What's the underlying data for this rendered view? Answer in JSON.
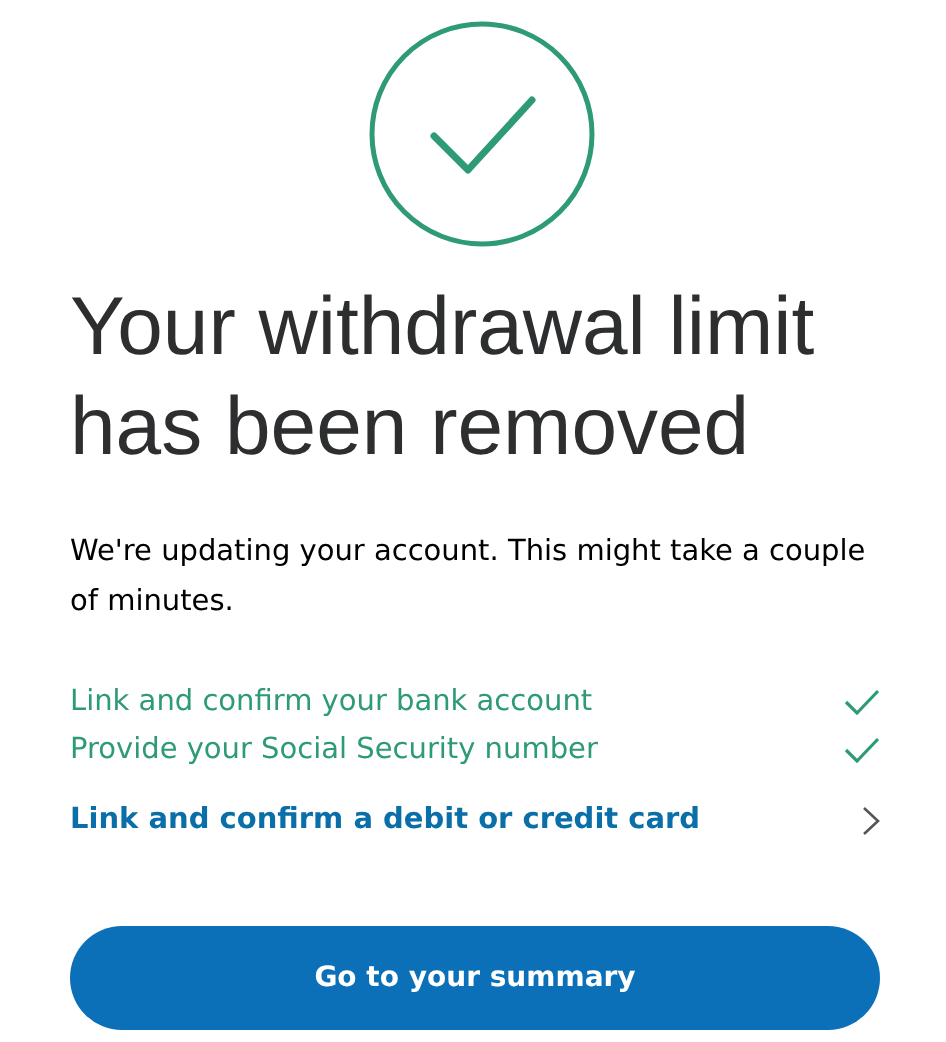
{
  "heading": [
    "Your withdrawal limit",
    "has been removed"
  ],
  "message": "We're updating your account. This might take a couple of minutes.",
  "steps": [
    {
      "label": "Link and confirm your bank account",
      "done": true
    },
    {
      "label": "Provide your Social Security number",
      "done": true
    },
    {
      "label": "Link and confirm a debit or credit card",
      "done": false
    }
  ],
  "button": "Go to your summary"
}
